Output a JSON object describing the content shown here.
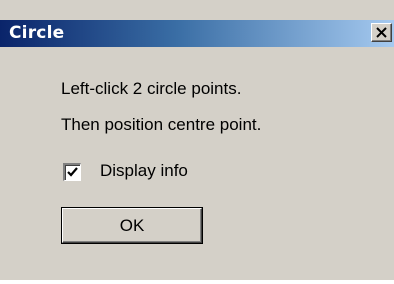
{
  "window": {
    "title": "Circle",
    "close_icon": "close-icon"
  },
  "dialog": {
    "message_line1": "Left-click 2 circle points.",
    "message_line2": "Then position centre point.",
    "display_info_label": "Display info",
    "display_info_checked": true,
    "ok_label": "OK"
  },
  "colors": {
    "titlebar_start": "#0a246a",
    "titlebar_end": "#a6caf0",
    "dialog_face": "#d4d0c8"
  }
}
